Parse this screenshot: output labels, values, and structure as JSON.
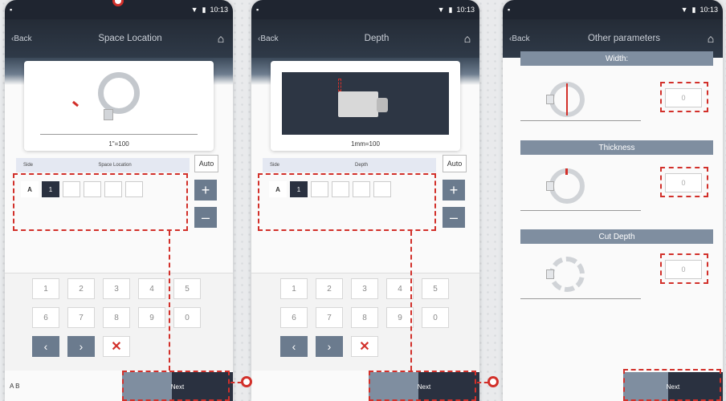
{
  "status": {
    "time": "10:13"
  },
  "screens": [
    {
      "back": "Back",
      "title": "Space Location",
      "scale": "1\"=100",
      "col_side": "Side",
      "col_param": "Space Location",
      "auto": "Auto",
      "row_label": "A",
      "active_cell": "1"
    },
    {
      "back": "Back",
      "title": "Depth",
      "scale": "1mm=100",
      "col_side": "Side",
      "col_param": "Depth",
      "auto": "Auto",
      "row_label": "A",
      "active_cell": "1"
    },
    {
      "back": "Back",
      "title": "Other parameters",
      "sections": [
        {
          "label": "Width:",
          "value": "0"
        },
        {
          "label": "Thickness",
          "value": "0"
        },
        {
          "label": "Cut Depth",
          "value": "0"
        }
      ]
    }
  ],
  "keypad": {
    "keys": [
      "1",
      "2",
      "3",
      "4",
      "5",
      "6",
      "7",
      "8",
      "9",
      "0"
    ]
  },
  "footer": {
    "ab": "A  B",
    "next": "Next"
  },
  "colors": {
    "accent": "#d2302a",
    "header": "#242b36",
    "button": "#6b7b8e"
  }
}
